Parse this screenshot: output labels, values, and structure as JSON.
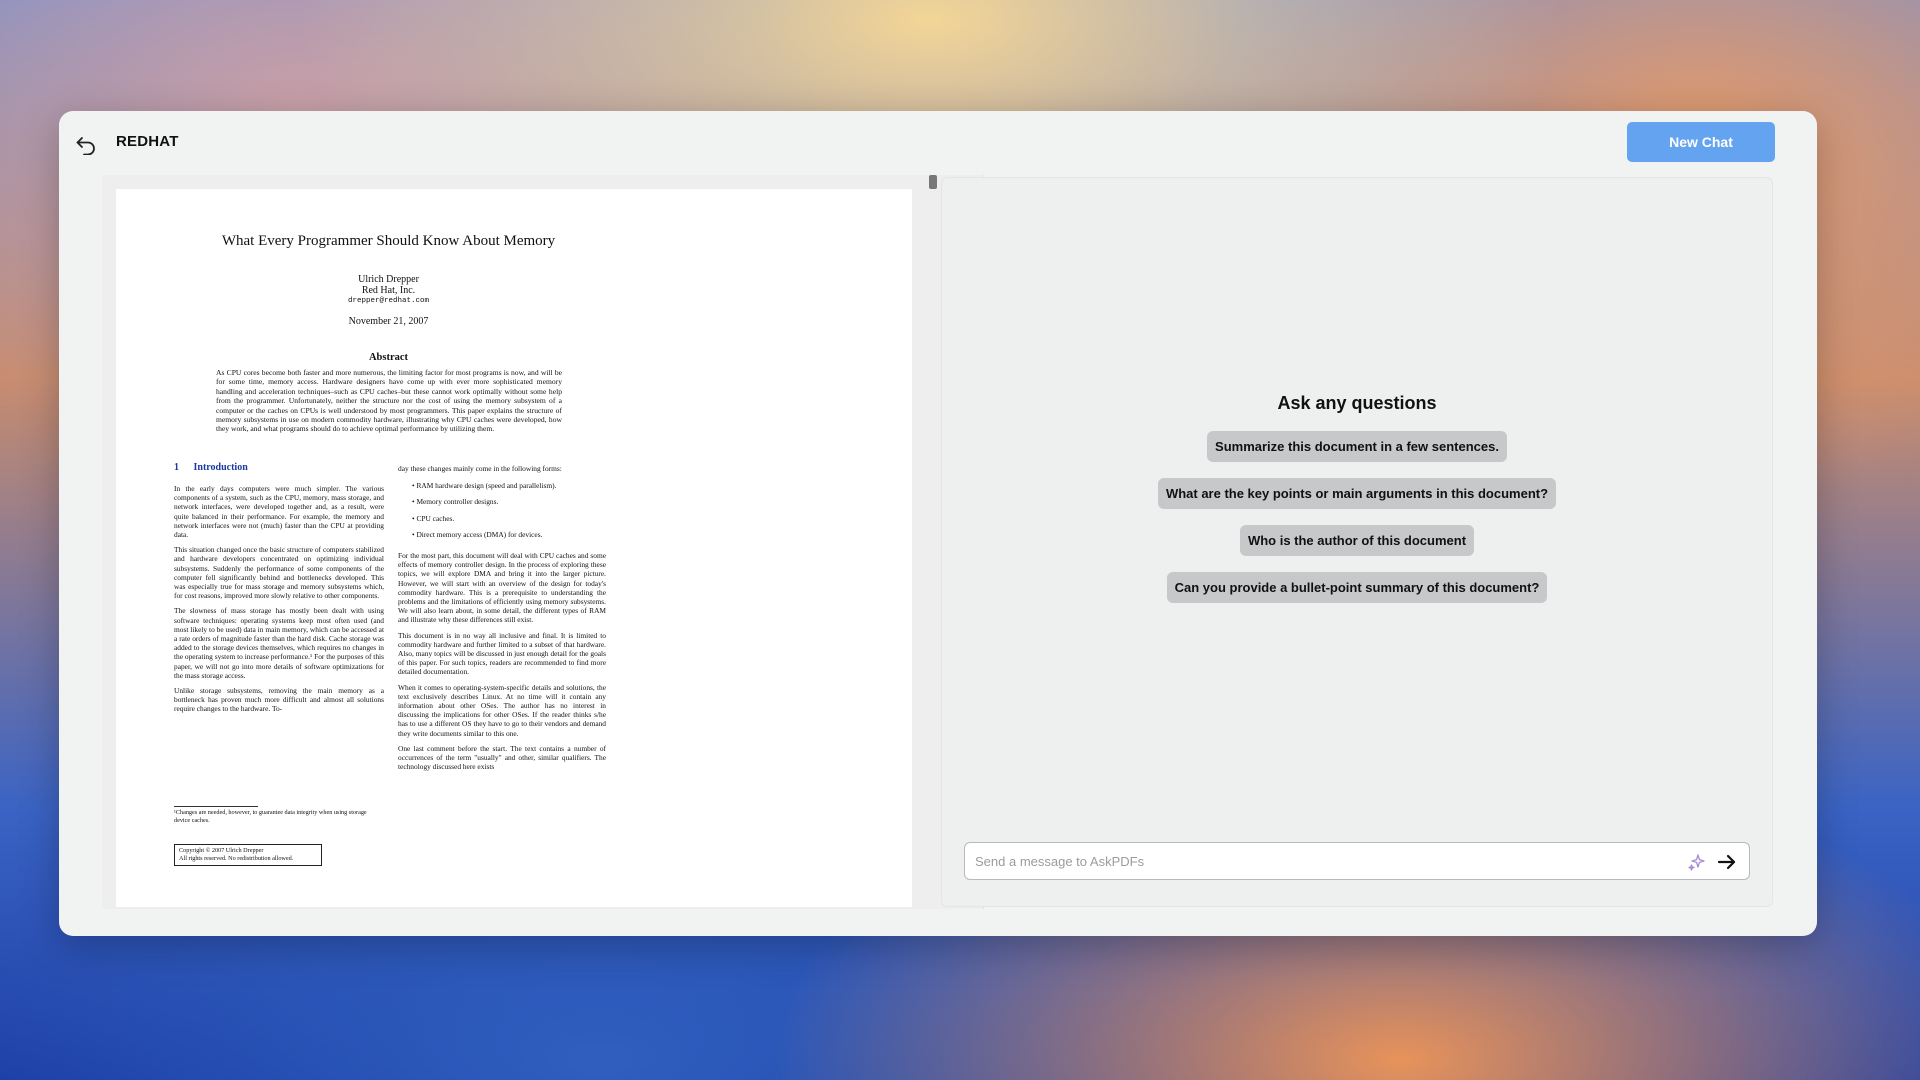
{
  "header": {
    "title": "REDHAT",
    "new_chat_label": "New Chat"
  },
  "icons": {
    "back": "back-arrow-icon",
    "sparkle": "sparkle-icon",
    "send": "send-arrow-icon"
  },
  "colors": {
    "accent": "#64a3ef",
    "section_heading": "#1a3aa0"
  },
  "pdf": {
    "title": "What Every Programmer Should Know About Memory",
    "author_name": "Ulrich Drepper",
    "author_org": "Red Hat, Inc.",
    "author_email": "drepper@redhat.com",
    "date": "November 21, 2007",
    "abstract_heading": "Abstract",
    "abstract_text": "As CPU cores become both faster and more numerous, the limiting factor for most programs is now, and will be for some time, memory access. Hardware designers have come up with ever more sophisticated memory handling and acceleration techniques–such as CPU caches–but these cannot work optimally without some help from the programmer. Unfortunately, neither the structure nor the cost of using the memory subsystem of a computer or the caches on CPUs is well understood by most programmers. This paper explains the structure of memory subsystems in use on modern commodity hardware, illustrating why CPU caches were developed, how they work, and what programs should do to achieve optimal performance by utilizing them.",
    "section_number": "1",
    "section_title": "Introduction",
    "left_paragraphs": [
      "In the early days computers were much simpler. The various components of a system, such as the CPU, memory, mass storage, and network interfaces, were developed together and, as a result, were quite balanced in their performance. For example, the memory and network interfaces were not (much) faster than the CPU at providing data.",
      "This situation changed once the basic structure of computers stabilized and hardware developers concentrated on optimizing individual subsystems. Suddenly the performance of some components of the computer fell significantly behind and bottlenecks developed. This was especially true for mass storage and memory subsystems which, for cost reasons, improved more slowly relative to other components.",
      "The slowness of mass storage has mostly been dealt with using software techniques: operating systems keep most often used (and most likely to be used) data in main memory, which can be accessed at a rate orders of magnitude faster than the hard disk. Cache storage was added to the storage devices themselves, which requires no changes in the operating system to increase performance.¹ For the purposes of this paper, we will not go into more details of software optimizations for the mass storage access.",
      "Unlike storage subsystems, removing the main memory as a bottleneck has proven much more difficult and almost all solutions require changes to the hardware. To-"
    ],
    "footnote": "¹Changes are needed, however, to guarantee data integrity when using storage device caches.",
    "copyright_line1": "Copyright © 2007 Ulrich Drepper",
    "copyright_line2": "All rights reserved. No redistribution allowed.",
    "right_intro": "day these changes mainly come in the following forms:",
    "bullets": [
      "RAM hardware design (speed and parallelism).",
      "Memory controller designs.",
      "CPU caches.",
      "Direct memory access (DMA) for devices."
    ],
    "right_paragraphs": [
      "For the most part, this document will deal with CPU caches and some effects of memory controller design. In the process of exploring these topics, we will explore DMA and bring it into the larger picture. However, we will start with an overview of the design for today's commodity hardware. This is a prerequisite to understanding the problems and the limitations of efficiently using memory subsystems. We will also learn about, in some detail, the different types of RAM and illustrate why these differences still exist.",
      "This document is in no way all inclusive and final. It is limited to commodity hardware and further limited to a subset of that hardware. Also, many topics will be discussed in just enough detail for the goals of this paper. For such topics, readers are recommended to find more detailed documentation.",
      "When it comes to operating-system-specific details and solutions, the text exclusively describes Linux. At no time will it contain any information about other OSes. The author has no interest in discussing the implications for other OSes. If the reader thinks s/he has to use a different OS they have to go to their vendors and demand they write documents similar to this one.",
      "One last comment before the start. The text contains a number of occurrences of the term \"usually\" and other, similar qualifiers. The technology discussed here exists"
    ]
  },
  "chat": {
    "heading": "Ask any questions",
    "suggestions": [
      "Summarize this document in a few sentences.",
      "What are the key points or main arguments in this document?",
      "Who is the author of this document",
      "Can you provide a bullet-point summary of this document?"
    ],
    "input_placeholder": "Send a message to AskPDFs",
    "input_value": ""
  }
}
